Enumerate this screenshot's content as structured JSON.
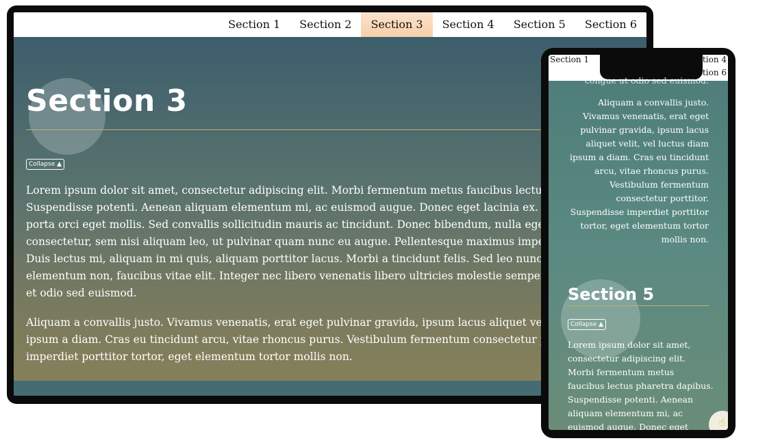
{
  "desktop": {
    "nav": {
      "items": [
        "Section 1",
        "Section 2",
        "Section 3",
        "Section 4",
        "Section 5",
        "Section 6"
      ],
      "active_index": 2
    },
    "section": {
      "title": "Section 3",
      "collapse_label": "Collapse ▲",
      "paragraph1_lines": [
        "Lorem ipsum dolor sit amet, consectetur adipiscing elit. Morbi fermentum metus faucibus lectus phar",
        "Suspendisse potenti. Aenean aliquam elementum mi, ac euismod augue. Donec eget lacinia ex. Phasell",
        "porta orci eget mollis. Sed convallis sollicitudin mauris ac tincidunt. Donec bibendum, nulla eget biben",
        "consectetur, sem nisi aliquam leo, ut pulvinar quam nunc eu augue. Pellentesque maximus imperdiet",
        "Duis lectus mi, aliquam in mi quis, aliquam porttitor lacus. Morbi a tincidunt felis. Sed leo nunc, phare",
        "elementum non, faucibus vitae elit. Integer nec libero venenatis libero ultricies molestie semper in tel",
        "et odio sed euismod."
      ],
      "paragraph2_lines": [
        "Aliquam a convallis justo. Vivamus venenatis, erat eget pulvinar gravida, ipsum lacus aliquet velit, vel",
        "ipsum a diam. Cras eu tincidunt arcu, vitae rhoncus purus. Vestibulum fermentum consectetur porttit",
        "imperdiet porttitor tortor, eget elementum tortor mollis non."
      ]
    }
  },
  "phone": {
    "nav": {
      "item1": "Section 1",
      "item4": "ection 4",
      "item6": "ection 6"
    },
    "cut_line": "congue ut odio sed euismod.",
    "right_para_lines": [
      "Aliquam a convallis justo.",
      "Vivamus venenatis, erat eget",
      "pulvinar gravida, ipsum lacus",
      "aliquet velit, vel luctus diam",
      "ipsum a diam. Cras eu tincidunt",
      "arcu, vitae rhoncus purus.",
      "Vestibulum fermentum",
      "consectetur porttitor.",
      "Suspendisse imperdiet porttitor",
      "tortor, eget elementum tortor",
      "mollis non."
    ],
    "section": {
      "title": "Section 5",
      "collapse_label": "Collapse ▲",
      "paragraph_lines": [
        "Lorem ipsum dolor sit amet,",
        "consectetur adipiscing elit.",
        "Morbi fermentum metus",
        "faucibus lectus pharetra dapibus.",
        "Suspendisse potenti. Aenean",
        "aliquam elementum mi, ac",
        "euismod augue. Donec eget"
      ]
    },
    "fab_icon": "pointer-hand-icon"
  }
}
